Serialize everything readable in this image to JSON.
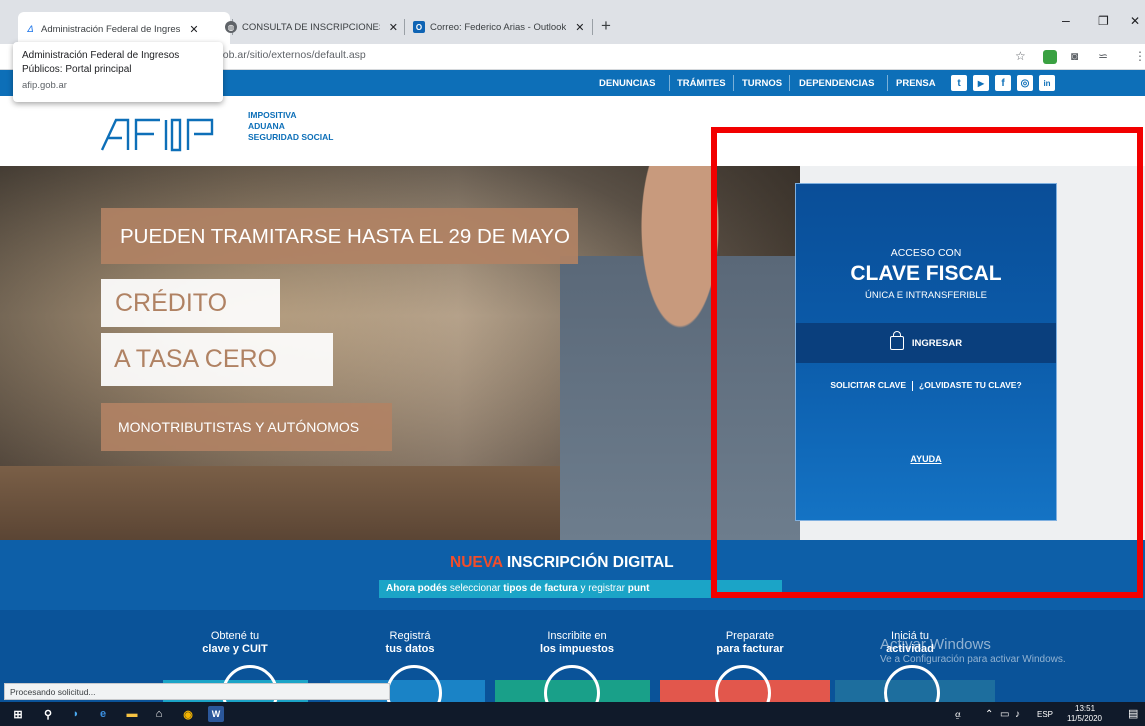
{
  "browser": {
    "tabs": [
      {
        "title": "Administración Federal de Ingres",
        "active": true,
        "favicon": "afip-icon"
      },
      {
        "title": "CONSULTA DE INSCRIPCIONES C",
        "active": false,
        "favicon": "globe-icon"
      },
      {
        "title": "Correo: Federico Arias - Outlook",
        "active": false,
        "favicon": "outlook-icon"
      }
    ],
    "close_glyph": "✕",
    "new_tab": "+",
    "url": ".gob.ar/sitio/externos/default.asp",
    "tooltip": {
      "title": "Administración Federal de Ingresos Públicos: Portal principal",
      "url": "afip.gob.ar"
    },
    "window_controls": {
      "minimize": "–",
      "maximize": "❐",
      "close": "✕"
    }
  },
  "site": {
    "nav": [
      "DENUNCIAS",
      "TRÁMITES",
      "TURNOS",
      "DEPENDENCIAS",
      "PRENSA"
    ],
    "social": [
      "twitter-icon",
      "youtube-icon",
      "facebook-icon",
      "instagram-icon",
      "linkedin-icon"
    ],
    "social_glyphs": [
      "t",
      "▶",
      "f",
      "◎",
      "in"
    ],
    "logo": "AFIP",
    "brand_lines": [
      "IMPOSITIVA",
      "ADUANA",
      "SEGURIDAD SOCIAL"
    ],
    "hero": {
      "banner1": "PUEDEN TRAMITARSE HASTA EL 29 DE MAYO",
      "banner2": "CRÉDITO",
      "banner3": "A TASA CERO",
      "banner4": "MONOTRIBUTISTAS Y AUTÓNOMOS"
    },
    "clave_fiscal": {
      "acceso": "ACCESO CON",
      "clave": "CLAVE FISCAL",
      "unica": "ÚNICA E INTRANSFERIBLE",
      "ingresar": "INGRESAR",
      "solicitar": "SOLICITAR CLAVE",
      "olvidaste": "¿OLVIDASTE TU CLAVE?",
      "ayuda": "AYUDA"
    },
    "nueva": {
      "highlight": "NUEVA",
      "title": "INSCRIPCIÓN DIGITAL",
      "sub_pre": "Ahora podés",
      "sub_mid": "seleccionar",
      "sub_bold": "tipos de factura",
      "sub_post": "y registrar",
      "sub_end": "punt"
    },
    "actions": [
      {
        "line1": "Obtené tu",
        "line2": "clave y CUIT"
      },
      {
        "line1": "Registrá",
        "line2": "tus datos"
      },
      {
        "line1": "Inscribite en",
        "line2": "los impuestos"
      },
      {
        "line1": "Preparate",
        "line2": "para facturar"
      },
      {
        "line1": "Iniciá tu",
        "line2": "actividad"
      }
    ],
    "watermark": "Activar Windows",
    "watermark_sub": "Ve a Configuración para activar Windows."
  },
  "status": "Procesando solicitud...",
  "taskbar": {
    "lang": "ESP",
    "time": "13:51",
    "date": "11/5/2020"
  },
  "colors": {
    "afip_blue": "#0d6fb8",
    "highlight": "#f20000",
    "hero_brown": "#b08263",
    "nueva_orange": "#f24d2a"
  }
}
